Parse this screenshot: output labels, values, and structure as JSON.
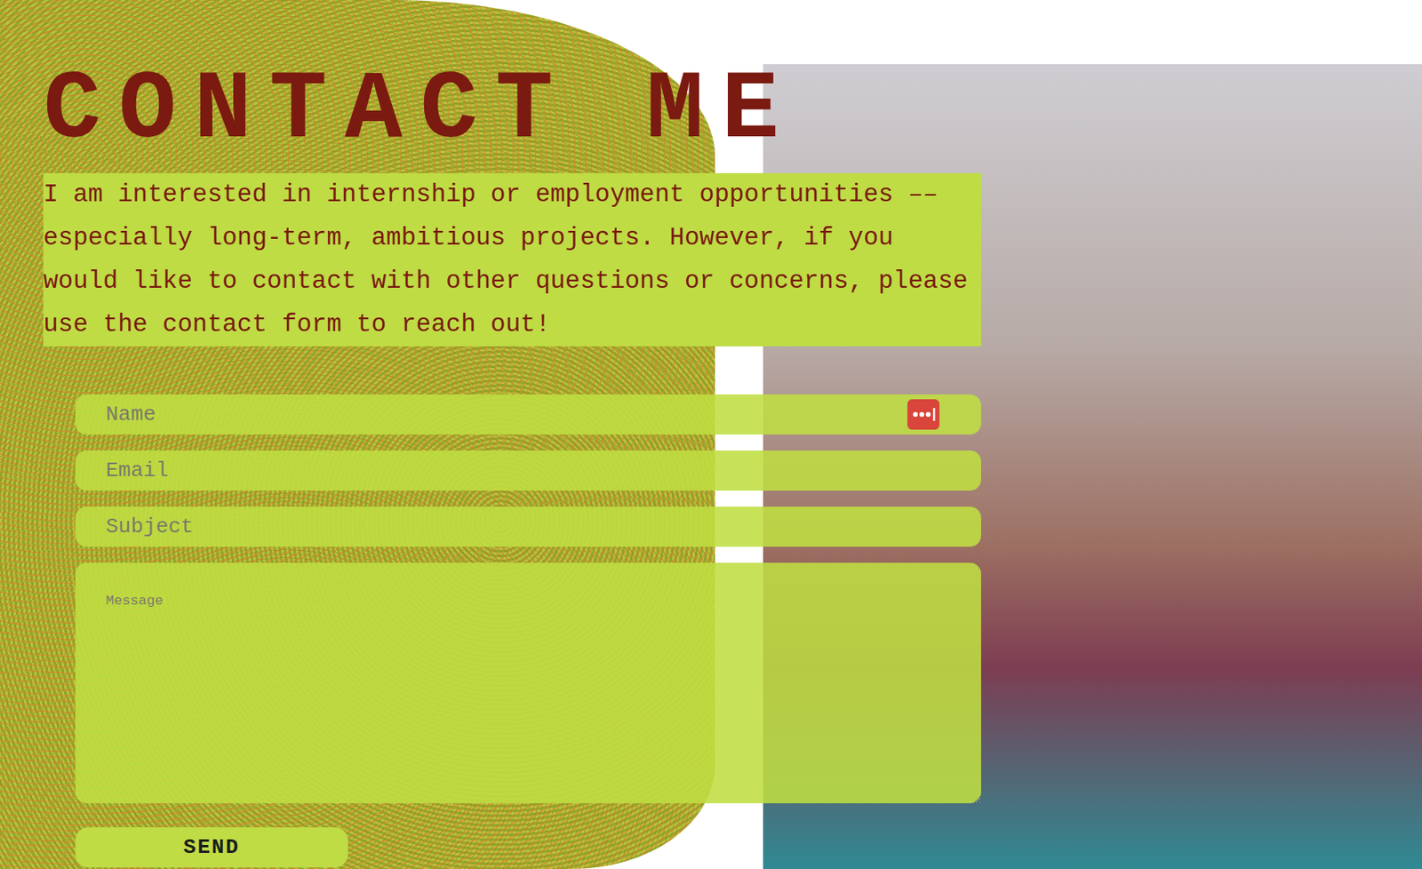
{
  "title": "CONTACT ME",
  "intro": "I am interested in internship or employment opportunities –– especially long-term, ambitious projects. However, if you would like to contact with other questions or concerns, please use the contact form to reach out!",
  "form": {
    "fields": [
      {
        "kind": "input",
        "placeholder": "Name",
        "autofill": true
      },
      {
        "kind": "input",
        "placeholder": "Email",
        "autofill": false
      },
      {
        "kind": "input",
        "placeholder": "Subject",
        "autofill": false
      },
      {
        "kind": "textarea",
        "placeholder": "Message",
        "autofill": false
      }
    ],
    "button": "SEND"
  }
}
